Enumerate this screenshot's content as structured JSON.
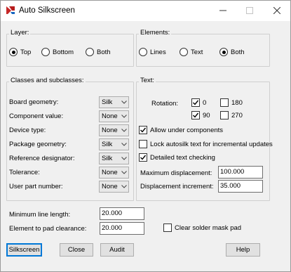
{
  "window": {
    "title": "Auto Silkscreen"
  },
  "layer": {
    "legend": "Layer:",
    "options": [
      {
        "label": "Top",
        "selected": true
      },
      {
        "label": "Bottom",
        "selected": false
      },
      {
        "label": "Both",
        "selected": false
      }
    ]
  },
  "elements": {
    "legend": "Elements:",
    "options": [
      {
        "label": "Lines",
        "selected": false
      },
      {
        "label": "Text",
        "selected": false
      },
      {
        "label": "Both",
        "selected": true
      }
    ]
  },
  "classes": {
    "legend": "Classes and subclasses:",
    "rows": [
      {
        "label": "Board geometry:",
        "value": "Silk"
      },
      {
        "label": "Component value:",
        "value": "None"
      },
      {
        "label": "Device type:",
        "value": "None"
      },
      {
        "label": "Package geometry:",
        "value": "Silk"
      },
      {
        "label": "Reference designator:",
        "value": "Silk"
      },
      {
        "label": "Tolerance:",
        "value": "None"
      },
      {
        "label": "User part number:",
        "value": "None"
      }
    ]
  },
  "text": {
    "legend": "Text:",
    "rotation_label": "Rotation:",
    "rotations": [
      {
        "label": "0",
        "checked": true
      },
      {
        "label": "180",
        "checked": false
      },
      {
        "label": "90",
        "checked": true
      },
      {
        "label": "270",
        "checked": false
      }
    ],
    "allow_under_components": {
      "label": "Allow under components",
      "checked": true
    },
    "lock_autosilk": {
      "label": "Lock autosilk text for incremental updates",
      "checked": false
    },
    "detailed_checking": {
      "label": "Detailed text checking",
      "checked": true
    },
    "max_displacement": {
      "label": "Maximum displacement:",
      "value": "100.000"
    },
    "displacement_increment": {
      "label": "Displacement increment:",
      "value": "35.000"
    }
  },
  "bottom": {
    "min_line_length": {
      "label": "Minimum line length:",
      "value": "20.000"
    },
    "element_to_pad": {
      "label": "Element to pad clearance:",
      "value": "20.000"
    },
    "clear_solder_mask": {
      "label": "Clear solder mask pad",
      "checked": false
    }
  },
  "buttons": {
    "silkscreen": "Silkscreen",
    "close": "Close",
    "audit": "Audit",
    "help": "Help"
  },
  "colors": {
    "focus": "#0078d7",
    "face": "#f0f0f0"
  }
}
